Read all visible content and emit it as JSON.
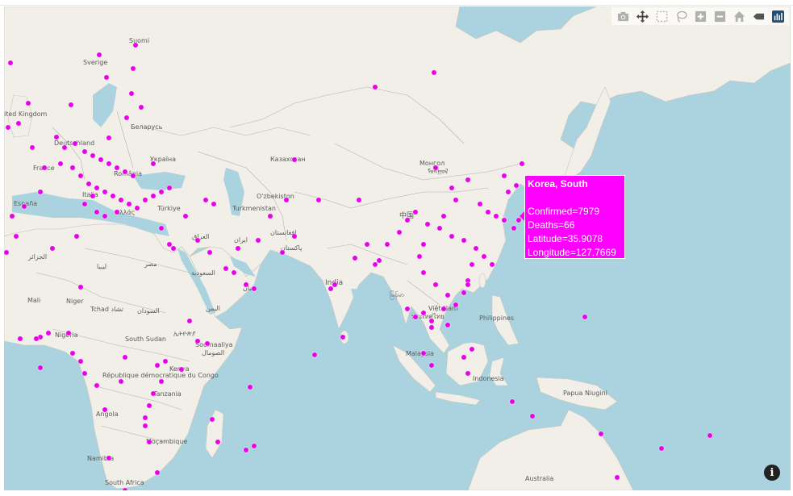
{
  "map": {
    "colors": {
      "water": "#aad3df",
      "land": "#f2efe9",
      "border": "#a6a6a6",
      "marker": "#e800e8",
      "tooltip_bg": "#ff00ff"
    },
    "labels": {
      "suomi": "Suomi",
      "sverige": "Sverige",
      "united_kingdom": "ited Kingdom",
      "belarus": "Беларусь",
      "deutschland": "Deutschland",
      "ukraina": "Україна",
      "france": "France",
      "romania": "România",
      "espana": "España",
      "italia": "Italia",
      "turkiye": "Türkiye",
      "ellas": "Ελλάς",
      "kazakhstan": "Казахстан",
      "uzbekistan": "O'zbekiston",
      "turkmenistan": "Turkmenistan",
      "mongol": "Монгол",
      "mongol_script": "ᠮᠣᠩᠭᠣᠯ",
      "china": "中国",
      "iraq": "العراق",
      "iran": "ایران",
      "afghanistan": "افغانستان",
      "pakistan": "پاکستان",
      "algeria": "الجزائر",
      "libya": "ليبيا",
      "egypt": "مصر",
      "saudi": "السعودية",
      "oman": "عمان",
      "yemen": "اليمن",
      "india": "India",
      "myanmar": "မြန်မာ",
      "vietnam": "Việt Nam",
      "thailand": "ประเทศไทย",
      "philippines": "Philippines",
      "malaysia": "Malaysia",
      "indonesia": "Indonesia",
      "papua": "Papua Niugini",
      "mali": "Mali",
      "niger": "Niger",
      "tchad": "Tchad تشاد",
      "sudan": "السودان",
      "nigeria": "Nigeria",
      "south_sudan": "South Sudan",
      "ethiopia": "ኢትዮጵያ",
      "somaliland": "Soomaaliya",
      "somaliland_ar": "الصومال",
      "kenya": "Kenya",
      "drc": "République démocratique du Congo",
      "tanzania": "Tanzania",
      "angola": "Angola",
      "mocambique": "Moçambique",
      "namibia": "Namibia",
      "south_africa": "South Africa",
      "australia": "Australia"
    }
  },
  "tooltip": {
    "title": "Korea, South",
    "confirmed": "Confirmed=7979",
    "deaths": "Deaths=66",
    "latitude": "Latitude=35.9078",
    "longitude": "Longitude=127.7669"
  },
  "modebar": {
    "icons": [
      "camera-icon",
      "pan-icon",
      "box-select-icon",
      "lasso-icon",
      "zoom-in-icon",
      "zoom-out-icon",
      "home-icon",
      "spike-icon",
      "plotly-logo-icon"
    ]
  },
  "info_button": "i"
}
